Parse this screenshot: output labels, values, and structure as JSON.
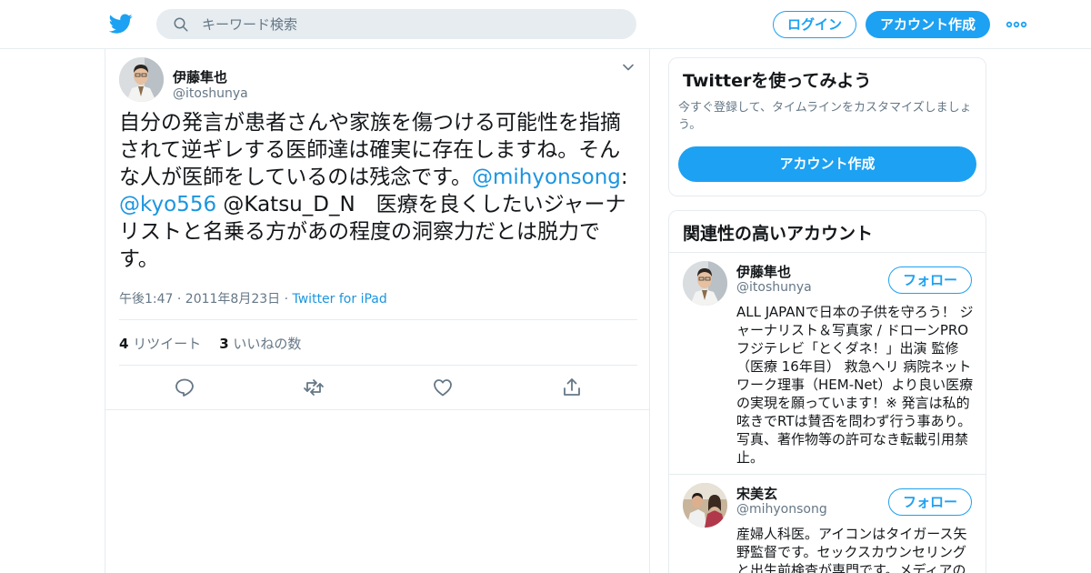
{
  "header": {
    "search_placeholder": "キーワード検索",
    "login_label": "ログイン",
    "signup_label": "アカウント作成"
  },
  "tweet": {
    "author_name": "伊藤隼也",
    "author_handle": "@itoshunya",
    "text_part1": "自分の発言が患者さんや家族を傷つける可能性を指摘されて逆ギレする医師達は確実に存在しますね。そんな人が医師をしているのは残念です。",
    "mention1": "@mihyonsong",
    "colon": ":",
    "mention2": "@kyo556",
    "text_part2": " @Katsu_D_N　医療を良くしたいジャーナリストと名乗る方があの程度の洞察力だとは脱力です。",
    "timestamp": "午後1:47 · 2011年8月23日 · ",
    "via": "Twitter for iPad",
    "retweet_count": "4",
    "retweet_label": " リツイート",
    "like_count": "3",
    "like_label": " いいねの数"
  },
  "signup_card": {
    "title": "Twitterを使ってみよう",
    "subtitle": "今すぐ登録して、タイムラインをカスタマイズしましょう。",
    "button_label": "アカウント作成"
  },
  "related": {
    "title": "関連性の高いアカウント",
    "accounts": [
      {
        "name": "伊藤隼也",
        "handle": "@itoshunya",
        "follow_label": "フォロー",
        "bio": "ALL JAPANで日本の子供を守ろう！ ジャーナリスト＆写真家 / ドローンPRO フジテレビ「とくダネ！」出演 監修（医療 16年目） 救急ヘリ 病院ネットワーク理事（HEM-Net）より良い医療の実現を願っています！※ 発言は私的呟きでRTは賛否を問わず行う事あり。写真、著作物等の許可なき転載引用禁止。"
      },
      {
        "name": "宋美玄",
        "handle": "@mihyonsong",
        "follow_label": "フォロー",
        "bio": "産婦人科医。アイコンはタイガース矢野監督です。セックスカウンセリングと出生前検査が専門です。メディアの"
      }
    ]
  },
  "colors": {
    "accent": "#1da1f2",
    "link": "#1b95e0",
    "secondary_text": "#657786",
    "border": "#e6ecf0"
  },
  "icons": [
    "twitter-bird-icon",
    "search-icon",
    "more-dots-icon",
    "chevron-down-icon",
    "reply-icon",
    "retweet-icon",
    "like-icon",
    "share-icon"
  ]
}
